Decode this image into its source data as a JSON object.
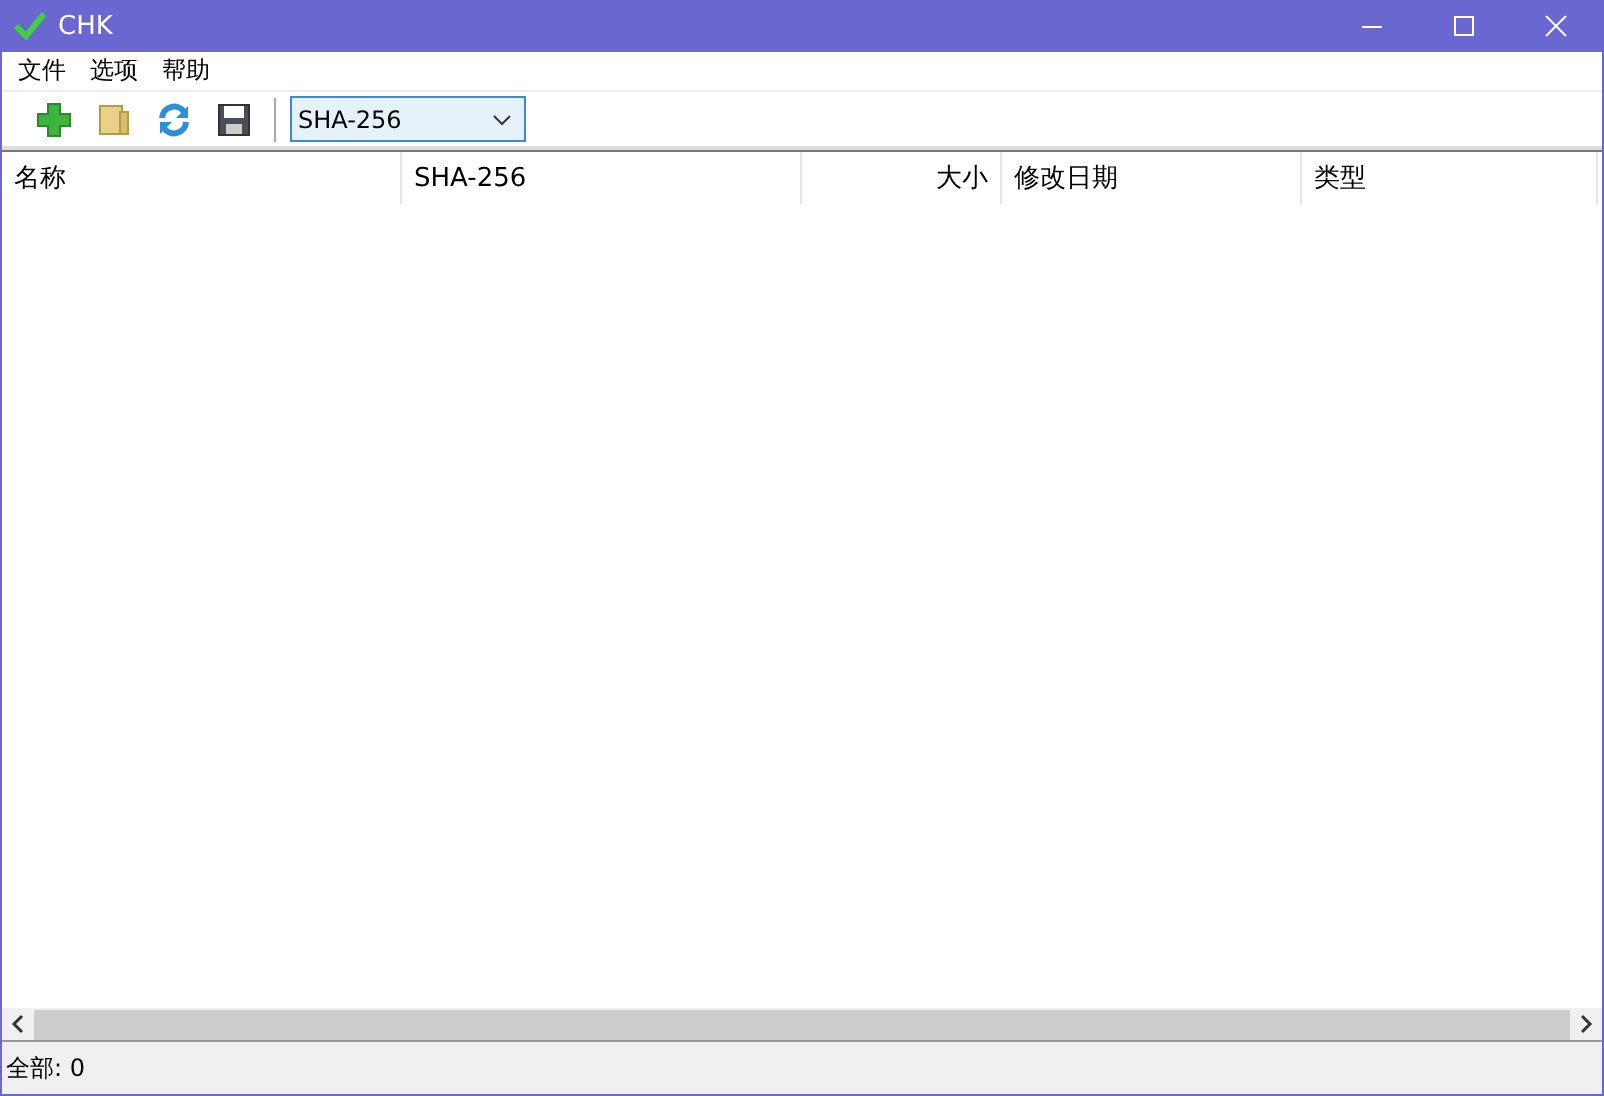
{
  "window": {
    "title": "CHK"
  },
  "menu": [
    "文件",
    "选项",
    "帮助"
  ],
  "toolbar": {
    "algorithm": "SHA-256"
  },
  "table": {
    "columns": [
      "名称",
      "SHA-256",
      "大小",
      "修改日期",
      "类型"
    ]
  },
  "status_bar": "全部: 0"
}
